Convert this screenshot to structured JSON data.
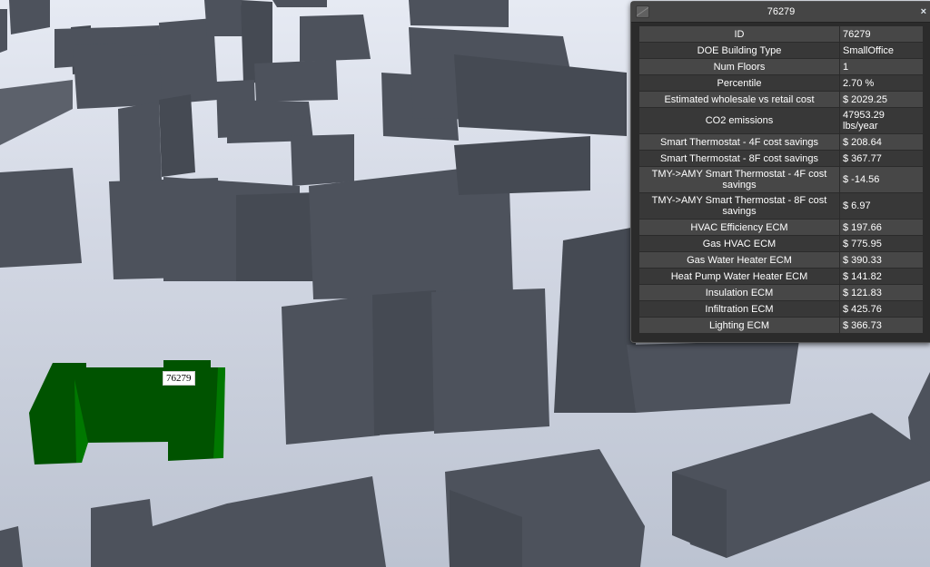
{
  "scene": {
    "selected_building_label": "76279",
    "colors": {
      "background_top": "#e6eaf3",
      "background_bottom": "#bcc3d1",
      "building": "#4d525c",
      "building_shade": "#454a53",
      "building_light": "#5c616b",
      "selected_building": "#005300",
      "selected_building_light": "#007800"
    }
  },
  "panel": {
    "title": "76279",
    "close_label": "×",
    "rows": [
      {
        "key": "ID",
        "value": "76279"
      },
      {
        "key": "DOE Building Type",
        "value": "SmallOffice"
      },
      {
        "key": "Num Floors",
        "value": "1"
      },
      {
        "key": "Percentile",
        "value": "2.70 %"
      },
      {
        "key": "Estimated wholesale vs retail cost",
        "value": "$ 2029.25"
      },
      {
        "key": "CO2 emissions",
        "value": "47953.29 lbs/year"
      },
      {
        "key": "Smart Thermostat - 4F cost savings",
        "value": "$ 208.64"
      },
      {
        "key": "Smart Thermostat - 8F cost savings",
        "value": "$ 367.77"
      },
      {
        "key": "TMY->AMY Smart Thermostat - 4F cost savings",
        "value": "$ -14.56"
      },
      {
        "key": "TMY->AMY Smart Thermostat - 8F cost savings",
        "value": "$ 6.97"
      },
      {
        "key": "HVAC Efficiency ECM",
        "value": "$ 197.66"
      },
      {
        "key": "Gas HVAC ECM",
        "value": "$ 775.95"
      },
      {
        "key": "Gas Water Heater ECM",
        "value": "$ 390.33"
      },
      {
        "key": "Heat Pump Water Heater ECM",
        "value": "$ 141.82"
      },
      {
        "key": "Insulation ECM",
        "value": "$ 121.83"
      },
      {
        "key": "Infiltration ECM",
        "value": "$ 425.76"
      },
      {
        "key": "Lighting ECM",
        "value": "$ 366.73"
      }
    ]
  }
}
